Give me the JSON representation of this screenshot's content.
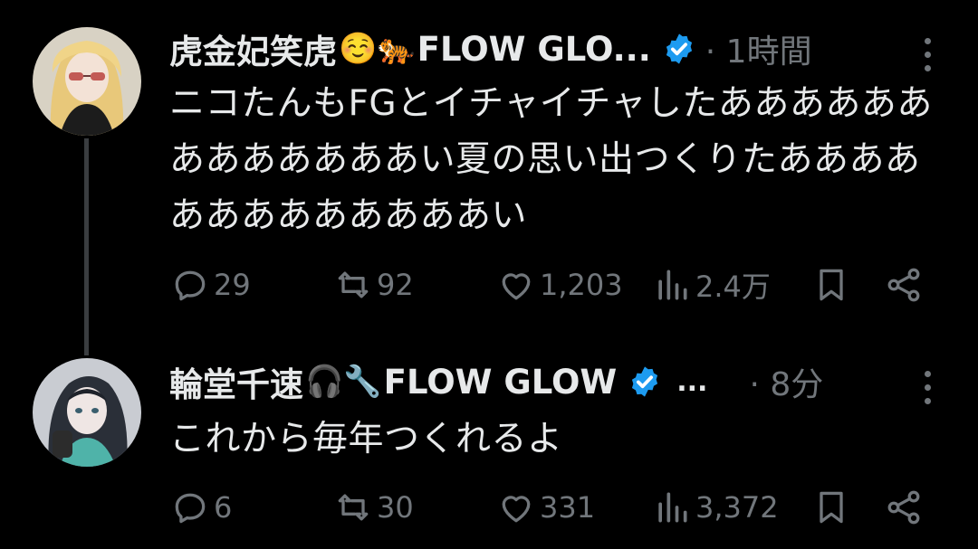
{
  "tweets": [
    {
      "author": "虎金妃笑虎",
      "emojis": "☺️🐅",
      "handle_suffix": "FLOW GLO...",
      "time": "· 1時間",
      "text": "ニコたんもFGとイチャイチャしたあああああああああああああい夏の思い出つくりたあああああああああああああい",
      "stats": {
        "replies": "29",
        "retweets": "92",
        "likes": "1,203",
        "views": "2.4万"
      },
      "avatar_icon": "avatar-blonde-girl",
      "more_icon": "more-vertical-icon"
    },
    {
      "author": "輪堂千速",
      "emojis": "🎧🔧",
      "handle_suffix": "FLOW GLOW",
      "ellipsis": "...",
      "time": "· 8分",
      "text": "これから毎年つくれるよ",
      "stats": {
        "replies": "6",
        "retweets": "30",
        "likes": "331",
        "views": "3,372"
      },
      "avatar_icon": "avatar-dark-hair-girl",
      "more_icon": "more-vertical-icon"
    }
  ],
  "colors": {
    "background": "#000000",
    "text": "#e7e9ea",
    "muted": "#71767b",
    "verified": "#1d9bf0",
    "thread_line": "#3a3d40"
  }
}
